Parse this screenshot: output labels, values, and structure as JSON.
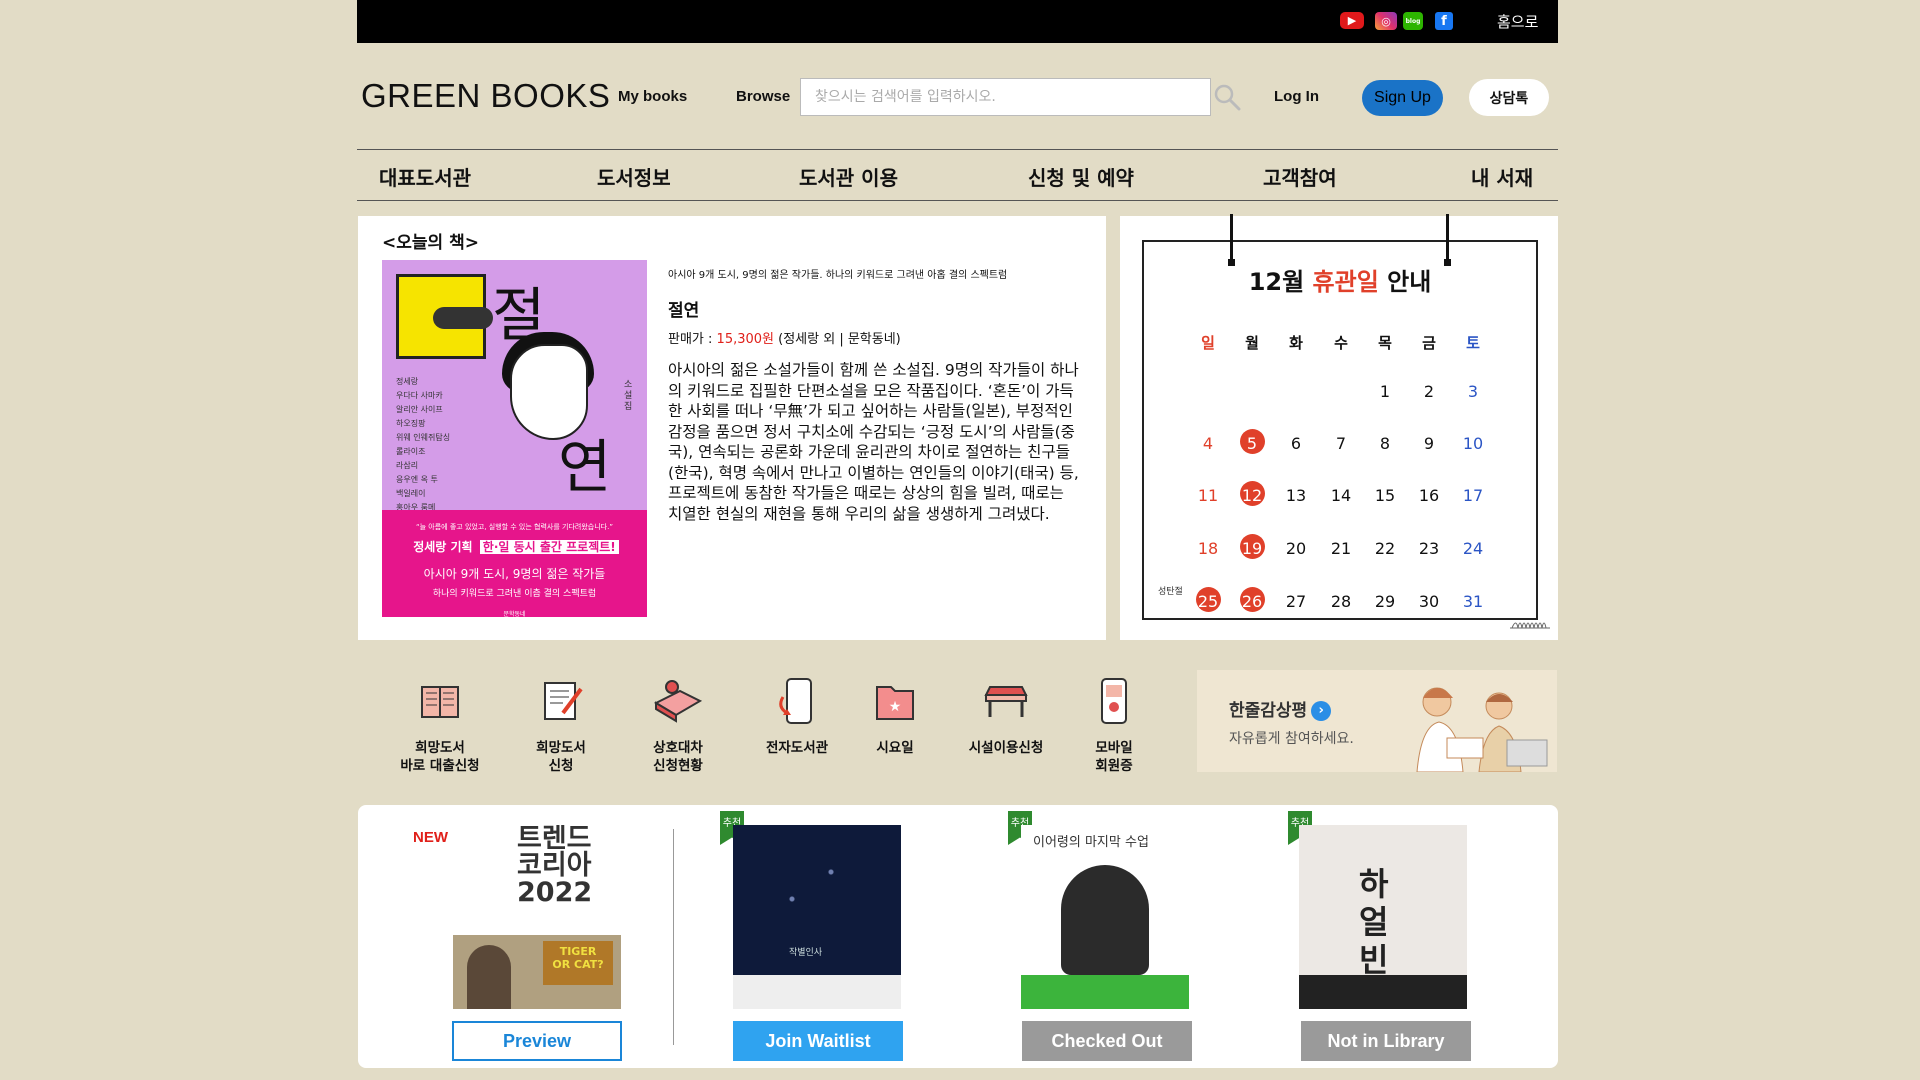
{
  "topbar": {
    "social": [
      "youtube-icon",
      "instagram-icon",
      "blog-icon",
      "facebook-icon"
    ],
    "social_text": {
      "youtube": "▶",
      "instagram": "◎",
      "blog": "blog",
      "facebook": "f"
    },
    "home_label": "홈으로"
  },
  "header": {
    "logo": "GREEN BOOKS",
    "my_books": "My books",
    "browse": "Browse",
    "search_placeholder": "찾으시는 검색어를 입력하시오.",
    "login": "Log In",
    "signup": "Sign Up",
    "talk": "상담톡"
  },
  "menu": [
    "대표도서관",
    "도서정보",
    "도서관 이용",
    "신청 및 예약",
    "고객참여",
    "내 서재"
  ],
  "today_book": {
    "panel_title": "<오늘의 책>",
    "cover": {
      "title_top": "절",
      "title_bottom": "연",
      "authors": [
        "정세랑",
        "우다다 사마카",
        "알리안 사이프",
        "하오징팡",
        "위웨 인웨쥐탐싱",
        "롤라이조",
        "라삼리",
        "응우엔 옥 투",
        "백일레이",
        "홍아우 룸메"
      ],
      "side_label": "소설집",
      "band_quote": "“늘 아름에 좋고 있었고, 실행할 수 있는 협력사를 기다려왔습니다.”",
      "band_line_prefix": "정세랑 기획",
      "band_line_highlight": "한·일 동시 출간 프로젝트!",
      "band_subtitle": "아시아 9개 도시, 9명의 젊은 작가들",
      "band_sub2": "하나의 키워드로 그려낸 이츰 결의 스펙트럼",
      "publisher": "문학동네"
    },
    "subtitle": "아시아 9개 도시, 9명의 젊은 작가들. 하나의 키워드로 그려낸 아홉 결의 스펙트럼",
    "name": "절연",
    "price_label": "판매가 :",
    "price": "15,300원",
    "price_suffix": "(정세랑 외 | 문학동네)",
    "description": "아시아의 젊은 소설가들이 함께 쓴 소설집. 9명의 작가들이 하나의 키워드로 집필한 단편소설을 모은 작품집이다. ‘혼돈’이 가득한 사회를 떠나 ‘무無’가 되고 싶어하는 사람들(일본), 부정적인 감정을 품으면 정서 구치소에 수감되는 ‘긍정 도시’의 사람들(중국), 연속되는 공론화 가운데 윤리관의 차이로 절연하는 친구들(한국), 혁명 속에서 만나고 이별하는 연인들의 이야기(태국) 등, 프로젝트에 동참한 작가들은 때로는 상상의 힘을 빌려, 때로는 치열한 현실의 재현을 통해 우리의 삶을 생생하게 그려냈다."
  },
  "calendar": {
    "title_prefix": "12월 ",
    "title_highlight": "휴관일",
    "title_suffix": " 안내",
    "weekdays": [
      "일",
      "월",
      "화",
      "수",
      "목",
      "금",
      "토"
    ],
    "rows": [
      [
        "",
        "",
        "",
        "",
        "1",
        "2",
        "3"
      ],
      [
        "4",
        "5",
        "6",
        "7",
        "8",
        "9",
        "10"
      ],
      [
        "11",
        "12",
        "13",
        "14",
        "15",
        "16",
        "17"
      ],
      [
        "18",
        "19",
        "20",
        "21",
        "22",
        "23",
        "24"
      ],
      [
        "25",
        "26",
        "27",
        "28",
        "29",
        "30",
        "31"
      ]
    ],
    "closed_days": [
      "5",
      "12",
      "19",
      "25",
      "26"
    ],
    "holiday_note": "성탄절",
    "colors": {
      "closed": "#e0402a",
      "saturday": "#2b55c5"
    }
  },
  "quick_menu": [
    {
      "icon": "book-open-icon",
      "label": "희망도서\n바로 대출신청"
    },
    {
      "icon": "document-pen-icon",
      "label": "희망도서\n신청"
    },
    {
      "icon": "book-exchange-icon",
      "label": "상호대차\n신청현황"
    },
    {
      "icon": "ebook-tablet-icon",
      "label": "전자도서관"
    },
    {
      "icon": "folder-star-icon",
      "label": "시요일"
    },
    {
      "icon": "desk-icon",
      "label": "시설이용신청"
    },
    {
      "icon": "mobile-card-icon",
      "label": "모바일\n회원증"
    }
  ],
  "banner": {
    "title": "한줄감상평",
    "arrow": "›",
    "subtitle": "자유롭게 참여하세요."
  },
  "book_list": [
    {
      "badge": "NEW",
      "cover_title": "트렌드\n코리아\n2022",
      "button": "Preview"
    },
    {
      "badge": "추천",
      "cover_title": "작별인사",
      "button": "Join Waitlist"
    },
    {
      "badge": "추천",
      "cover_title": "이어령의 마지막 수업",
      "button": "Checked Out"
    },
    {
      "badge": "추천",
      "cover_title": "하얼빈",
      "button": "Not in Library"
    }
  ]
}
